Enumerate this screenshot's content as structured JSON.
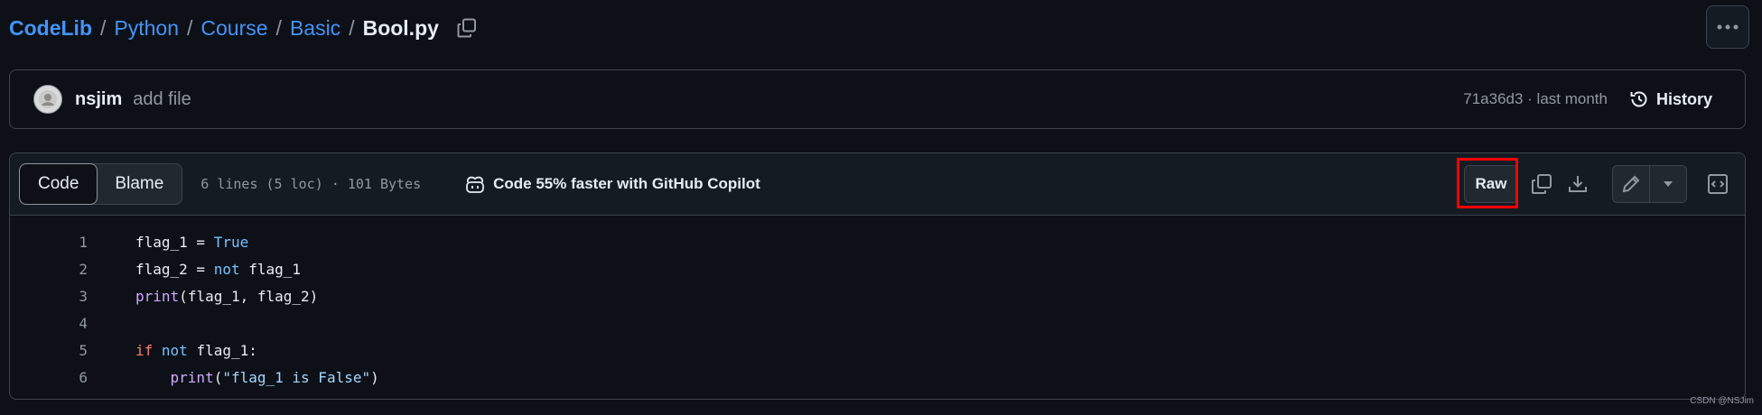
{
  "breadcrumb": {
    "root": "CodeLib",
    "separator": "/",
    "items": [
      "Python",
      "Course",
      "Basic"
    ],
    "file": "Bool.py"
  },
  "commit": {
    "author": "nsjim",
    "message": "add file",
    "meta": "71a36d3 · last month",
    "history_label": "History"
  },
  "file_header": {
    "tabs": [
      "Code",
      "Blame"
    ],
    "active_tab": "Code",
    "info": "6 lines (5 loc) · 101 Bytes",
    "copilot_text": "Code 55% faster with GitHub Copilot",
    "raw_label": "Raw"
  },
  "code_lines": [
    {
      "num": "1",
      "text": "flag_1 = True"
    },
    {
      "num": "2",
      "text": "flag_2 = not flag_1"
    },
    {
      "num": "3",
      "text": "print(flag_1, flag_2)"
    },
    {
      "num": "4",
      "text": ""
    },
    {
      "num": "5",
      "text": "if not flag_1:"
    },
    {
      "num": "6",
      "text": "    print(\"flag_1 is False\")"
    }
  ],
  "watermark": "CSDN @NSJim",
  "colors": {
    "background": "#0d1117",
    "link": "#4493f8",
    "highlight": "#ff0000",
    "keyword_blue": "#79c0ff",
    "keyword_red": "#ff7b72",
    "function_purple": "#d2a8ff",
    "string": "#a5d6ff"
  },
  "icons": [
    "copy-icon",
    "kebab-icon",
    "history-icon",
    "copilot-icon",
    "download-icon",
    "pencil-icon",
    "triangle-down-icon",
    "code-square-icon"
  ]
}
